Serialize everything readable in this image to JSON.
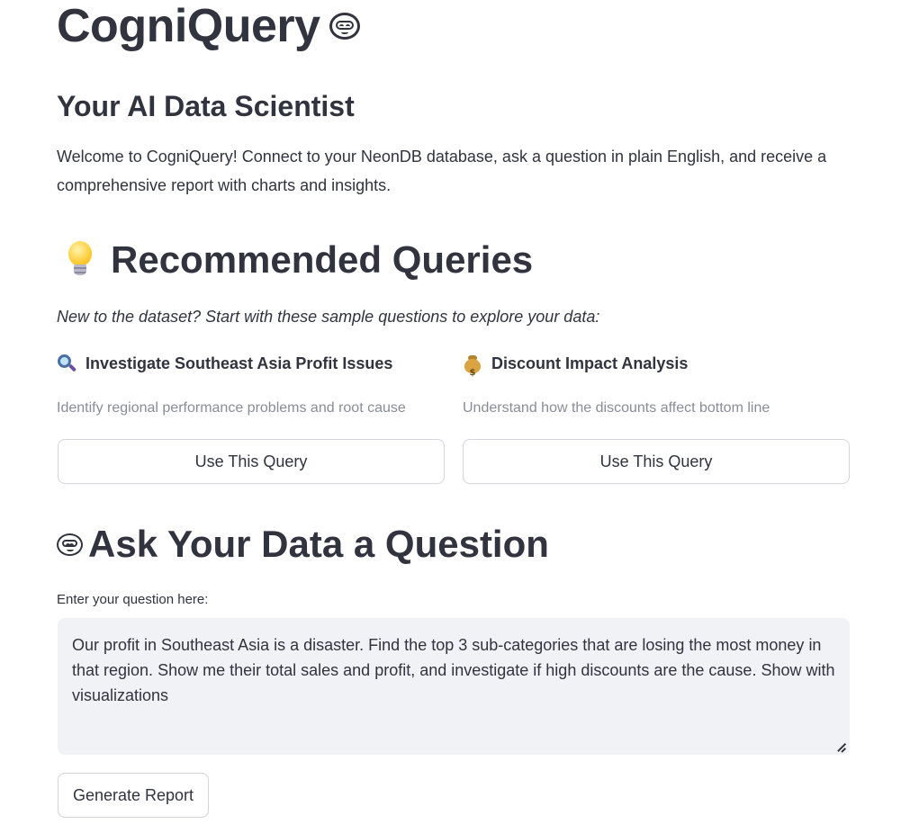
{
  "app": {
    "title": "CogniQuery",
    "title_icon": "robot-face-icon",
    "subtitle": "Your AI Data Scientist",
    "welcome": "Welcome to CogniQuery! Connect to your NeonDB database, ask a question in plain English, and receive a comprehensive report with charts and insights."
  },
  "recommended": {
    "heading": "Recommended Queries",
    "heading_icon": "light-bulb-icon",
    "intro": "New to the dataset? Start with these sample questions to explore your data:",
    "cards": [
      {
        "icon": "magnifying-glass-icon",
        "title": "Investigate Southeast Asia Profit Issues",
        "description": "Identify regional performance problems and root cause",
        "button_label": "Use This Query"
      },
      {
        "icon": "money-bag-icon",
        "title": "Discount Impact Analysis",
        "description": "Understand how the discounts affect bottom line",
        "button_label": "Use This Query"
      }
    ]
  },
  "ask": {
    "heading": "Ask Your Data a Question",
    "heading_icon": "robot-face-icon",
    "field_label": "Enter your question here:",
    "question_value": "Our profit in Southeast Asia is a disaster. Find the top 3 sub-categories that are losing the most money in that region. Show me their total sales and profit, and investigate if high discounts are the cause. Show with visualizations",
    "submit_label": "Generate Report"
  }
}
